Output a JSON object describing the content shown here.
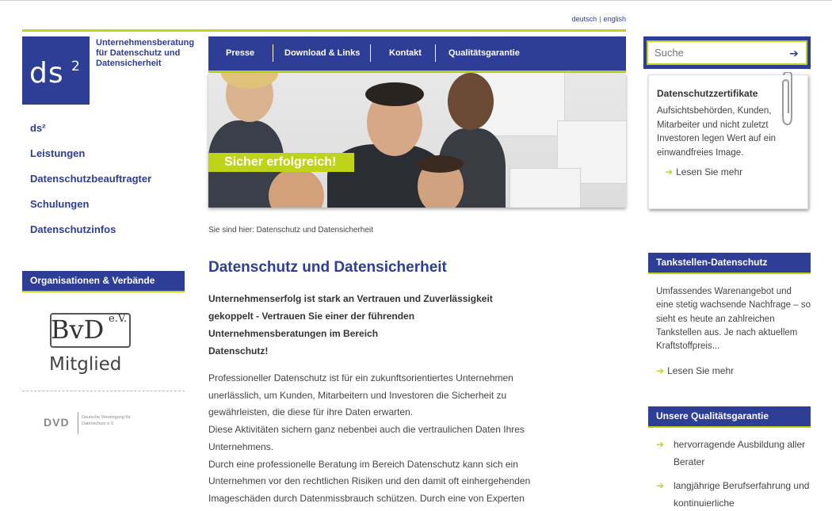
{
  "language": {
    "de": "deutsch",
    "separator": "|",
    "en": "english"
  },
  "logo": {
    "text": "ds",
    "sup": "2"
  },
  "tagline": "Unternehmensberatung für Datenschutz und Datensicherheit",
  "leftnav": [
    {
      "label": "ds²"
    },
    {
      "label": "Leistungen"
    },
    {
      "label": "Datenschutzbeauftragter"
    },
    {
      "label": "Schulungen"
    },
    {
      "label": "Datenschutzinfos"
    }
  ],
  "organisations": {
    "heading": "Organisationen & Verbände",
    "bvd": {
      "name": "BvD",
      "suffix": "e.V.",
      "subline": "Mitglied"
    },
    "dvd": {
      "name": "DVD",
      "full": "Deutsche Vereinigung für Datenschutz e.V."
    }
  },
  "mainnav": [
    {
      "label": "Presse"
    },
    {
      "label": "Download & Links"
    },
    {
      "label": "Kontakt"
    },
    {
      "label": "Qualitätsgarantie"
    }
  ],
  "search": {
    "placeholder": "Suche",
    "button": "➔"
  },
  "hero": {
    "slogan": "Sicher erfolgreich!"
  },
  "breadcrumb": "Sie sind hier: Datenschutz und Datensicherheit",
  "main": {
    "title": "Datenschutz und Datensicherheit",
    "intro_lines": [
      "Unternehmenserfolg ist stark an Vertrauen und Zuverlässigkeit",
      "gekoppelt - Vertrauen Sie einer der führenden",
      "Unternehmensberatungen im Bereich",
      "Datenschutz!"
    ],
    "body_lines": [
      "Professioneller Datenschutz ist für ein zukunftsorientiertes Unternehmen",
      "unerlässlich, um Kunden, Mitarbeitern und Investoren die Sicherheit zu",
      "gewährleisten, die diese für ihre Daten erwarten.",
      "Diese Aktivitäten sichern ganz nebenbei auch die vertraulichen Daten Ihres",
      "Unternehmens.",
      "Durch eine professionelle Beratung im Bereich Datenschutz kann sich ein",
      "Unternehmen vor den rechtlichen Risiken und den damit oft einhergehenden",
      "Imageschäden durch Datenmissbrauch schützen. Durch eine von Experten"
    ]
  },
  "certificates": {
    "title": "Datenschutzzertifikate",
    "text": "Aufsichtsbehörden, Kunden, Mitarbeiter und nicht zuletzt Investoren legen Wert auf ein einwandfreies Image.",
    "more": "Lesen Sie mehr"
  },
  "tankstellen": {
    "heading": "Tankstellen-Datenschutz",
    "text": "Umfassendes Warenangebot und eine stetig wachsende Nachfrage – so sieht es heute an zahlreichen Tankstellen aus. Je nach aktuellem Kraftstoffpreis...",
    "more": "Lesen Sie mehr"
  },
  "quality": {
    "heading": "Unsere Qualitätsgarantie",
    "items": [
      {
        "text": "hervorragende Ausbildung aller Berater"
      },
      {
        "text": "langjährige Berufserfahrung und kontinuierliche"
      }
    ]
  },
  "colors": {
    "brand_blue": "#2e3d95",
    "accent_lime": "#bfd318"
  },
  "icons": {
    "arrow": "arrow-right-icon",
    "paperclip": "paperclip-icon"
  }
}
